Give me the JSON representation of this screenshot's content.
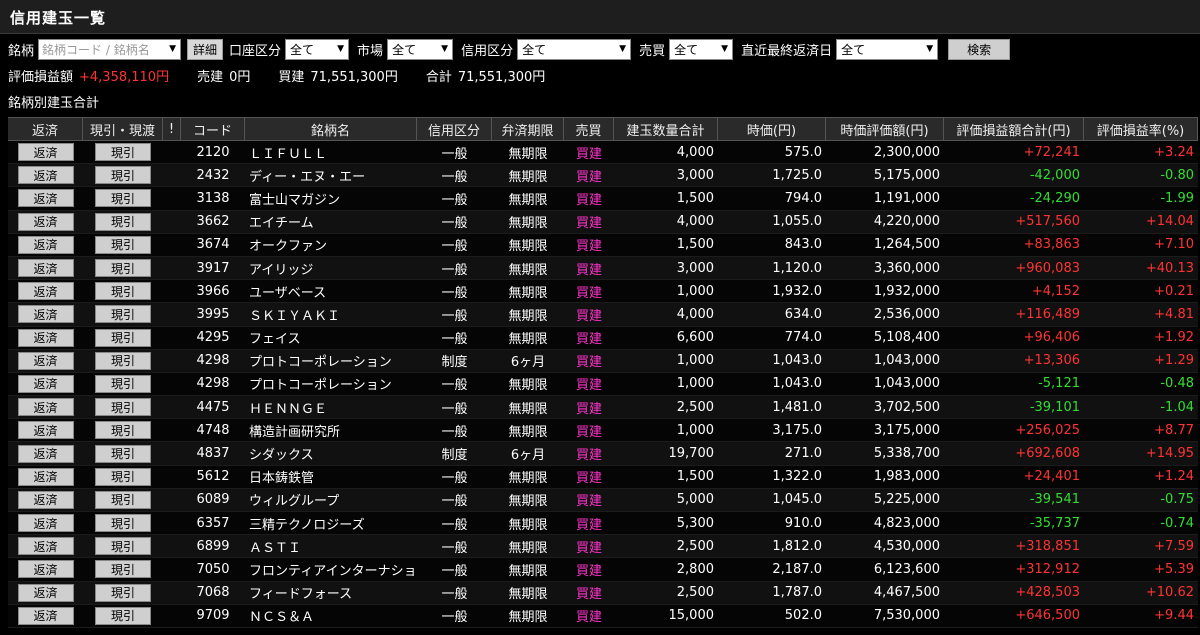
{
  "window": {
    "title": "信用建玉一覧"
  },
  "filters": {
    "meigara_label": "銘柄",
    "meigara_placeholder": "銘柄コード / 銘柄名",
    "detail_button": "詳細",
    "account_label": "口座区分",
    "account_value": "全て",
    "market_label": "市場",
    "market_value": "全て",
    "credit_label": "信用区分",
    "credit_value": "全て",
    "side_label": "売買",
    "side_value": "全て",
    "due_label": "直近最終返済日",
    "due_value": "全て",
    "search_button": "検索"
  },
  "summary": {
    "pl_label": "評価損益額",
    "pl_value": "+4,358,110円",
    "sell_label": "売建",
    "sell_value": "0円",
    "buy_label": "買建",
    "buy_value": "71,551,300円",
    "total_label": "合計",
    "total_value": "71,551,300円"
  },
  "section_label": "銘柄別建玉合計",
  "table": {
    "headers": [
      "返済",
      "現引・現渡",
      "!",
      "コード",
      "銘柄名",
      "信用区分",
      "弁済期限",
      "売買",
      "建玉数量合計",
      "時価(円)",
      "時価評価額(円)",
      "評価損益額合計(円)",
      "評価損益率(%)"
    ],
    "button_repay": "返済",
    "button_genbiki": "現引",
    "rows": [
      {
        "code": "2120",
        "name": "ＬＩＦＵＬＬ",
        "credit": "一般",
        "due": "無期限",
        "side": "買建",
        "qty": "4,000",
        "price": "575.0",
        "value": "2,300,000",
        "pl": "+72,241",
        "rate": "+3.24",
        "sign": "pos"
      },
      {
        "code": "2432",
        "name": "ディー・エヌ・エー",
        "credit": "一般",
        "due": "無期限",
        "side": "買建",
        "qty": "3,000",
        "price": "1,725.0",
        "value": "5,175,000",
        "pl": "-42,000",
        "rate": "-0.80",
        "sign": "neg"
      },
      {
        "code": "3138",
        "name": "富士山マガジン",
        "credit": "一般",
        "due": "無期限",
        "side": "買建",
        "qty": "1,500",
        "price": "794.0",
        "value": "1,191,000",
        "pl": "-24,290",
        "rate": "-1.99",
        "sign": "neg"
      },
      {
        "code": "3662",
        "name": "エイチーム",
        "credit": "一般",
        "due": "無期限",
        "side": "買建",
        "qty": "4,000",
        "price": "1,055.0",
        "value": "4,220,000",
        "pl": "+517,560",
        "rate": "+14.04",
        "sign": "pos"
      },
      {
        "code": "3674",
        "name": "オークファン",
        "credit": "一般",
        "due": "無期限",
        "side": "買建",
        "qty": "1,500",
        "price": "843.0",
        "value": "1,264,500",
        "pl": "+83,863",
        "rate": "+7.10",
        "sign": "pos"
      },
      {
        "code": "3917",
        "name": "アイリッジ",
        "credit": "一般",
        "due": "無期限",
        "side": "買建",
        "qty": "3,000",
        "price": "1,120.0",
        "value": "3,360,000",
        "pl": "+960,083",
        "rate": "+40.13",
        "sign": "pos"
      },
      {
        "code": "3966",
        "name": "ユーザベース",
        "credit": "一般",
        "due": "無期限",
        "side": "買建",
        "qty": "1,000",
        "price": "1,932.0",
        "value": "1,932,000",
        "pl": "+4,152",
        "rate": "+0.21",
        "sign": "pos"
      },
      {
        "code": "3995",
        "name": "ＳＫＩＹＡＫＩ",
        "credit": "一般",
        "due": "無期限",
        "side": "買建",
        "qty": "4,000",
        "price": "634.0",
        "value": "2,536,000",
        "pl": "+116,489",
        "rate": "+4.81",
        "sign": "pos"
      },
      {
        "code": "4295",
        "name": "フェイス",
        "credit": "一般",
        "due": "無期限",
        "side": "買建",
        "qty": "6,600",
        "price": "774.0",
        "value": "5,108,400",
        "pl": "+96,406",
        "rate": "+1.92",
        "sign": "pos"
      },
      {
        "code": "4298",
        "name": "プロトコーポレーション",
        "credit": "制度",
        "due": "6ヶ月",
        "side": "買建",
        "qty": "1,000",
        "price": "1,043.0",
        "value": "1,043,000",
        "pl": "+13,306",
        "rate": "+1.29",
        "sign": "pos"
      },
      {
        "code": "4298",
        "name": "プロトコーポレーション",
        "credit": "一般",
        "due": "無期限",
        "side": "買建",
        "qty": "1,000",
        "price": "1,043.0",
        "value": "1,043,000",
        "pl": "-5,121",
        "rate": "-0.48",
        "sign": "neg"
      },
      {
        "code": "4475",
        "name": "ＨＥＮＮＧＥ",
        "credit": "一般",
        "due": "無期限",
        "side": "買建",
        "qty": "2,500",
        "price": "1,481.0",
        "value": "3,702,500",
        "pl": "-39,101",
        "rate": "-1.04",
        "sign": "neg"
      },
      {
        "code": "4748",
        "name": "構造計画研究所",
        "credit": "一般",
        "due": "無期限",
        "side": "買建",
        "qty": "1,000",
        "price": "3,175.0",
        "value": "3,175,000",
        "pl": "+256,025",
        "rate": "+8.77",
        "sign": "pos"
      },
      {
        "code": "4837",
        "name": "シダックス",
        "credit": "制度",
        "due": "6ヶ月",
        "side": "買建",
        "qty": "19,700",
        "price": "271.0",
        "value": "5,338,700",
        "pl": "+692,608",
        "rate": "+14.95",
        "sign": "pos"
      },
      {
        "code": "5612",
        "name": "日本鋳鉄管",
        "credit": "一般",
        "due": "無期限",
        "side": "買建",
        "qty": "1,500",
        "price": "1,322.0",
        "value": "1,983,000",
        "pl": "+24,401",
        "rate": "+1.24",
        "sign": "pos"
      },
      {
        "code": "6089",
        "name": "ウィルグループ",
        "credit": "一般",
        "due": "無期限",
        "side": "買建",
        "qty": "5,000",
        "price": "1,045.0",
        "value": "5,225,000",
        "pl": "-39,541",
        "rate": "-0.75",
        "sign": "neg"
      },
      {
        "code": "6357",
        "name": "三精テクノロジーズ",
        "credit": "一般",
        "due": "無期限",
        "side": "買建",
        "qty": "5,300",
        "price": "910.0",
        "value": "4,823,000",
        "pl": "-35,737",
        "rate": "-0.74",
        "sign": "neg"
      },
      {
        "code": "6899",
        "name": "ＡＳＴＩ",
        "credit": "一般",
        "due": "無期限",
        "side": "買建",
        "qty": "2,500",
        "price": "1,812.0",
        "value": "4,530,000",
        "pl": "+318,851",
        "rate": "+7.59",
        "sign": "pos"
      },
      {
        "code": "7050",
        "name": "フロンティアインターナショナル",
        "credit": "一般",
        "due": "無期限",
        "side": "買建",
        "qty": "2,800",
        "price": "2,187.0",
        "value": "6,123,600",
        "pl": "+312,912",
        "rate": "+5.39",
        "sign": "pos"
      },
      {
        "code": "7068",
        "name": "フィードフォース",
        "credit": "一般",
        "due": "無期限",
        "side": "買建",
        "qty": "2,500",
        "price": "1,787.0",
        "value": "4,467,500",
        "pl": "+428,503",
        "rate": "+10.62",
        "sign": "pos"
      },
      {
        "code": "9709",
        "name": "ＮＣＳ＆Ａ",
        "credit": "一般",
        "due": "無期限",
        "side": "買建",
        "qty": "15,000",
        "price": "502.0",
        "value": "7,530,000",
        "pl": "+646,500",
        "rate": "+9.44",
        "sign": "pos"
      }
    ]
  },
  "colors": {
    "positive": "#ff3333",
    "negative": "#33dd33",
    "buy": "#ff33cc"
  }
}
